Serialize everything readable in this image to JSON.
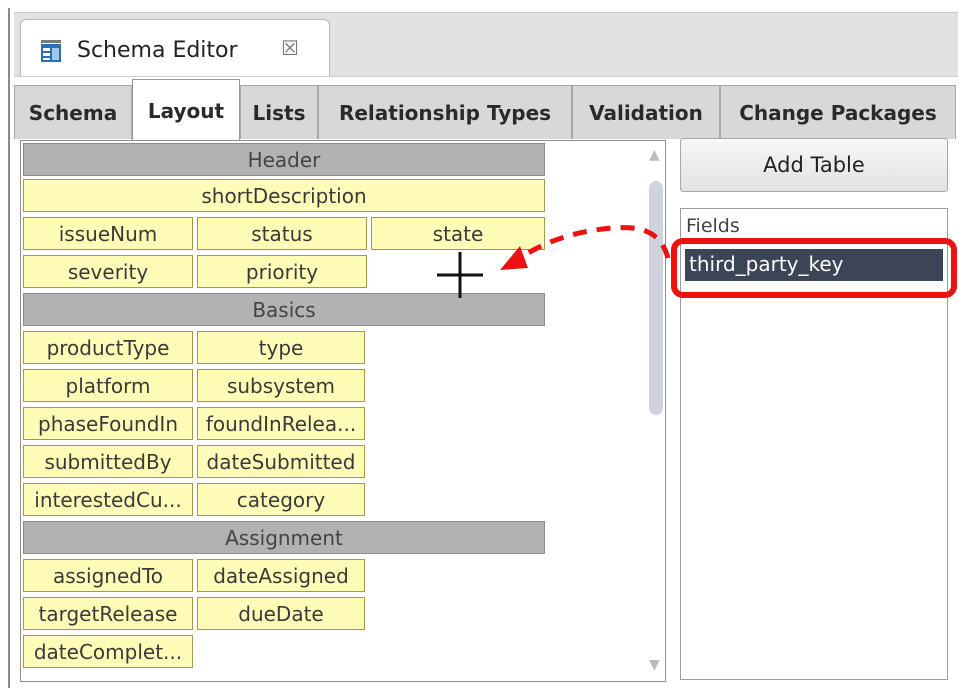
{
  "editor_tab": {
    "title": "Schema Editor",
    "close_glyph": "☒"
  },
  "tabs": [
    {
      "label": "Schema",
      "active": false
    },
    {
      "label": "Layout",
      "active": true
    },
    {
      "label": "Lists",
      "active": false
    },
    {
      "label": "Relationship Types",
      "active": false
    },
    {
      "label": "Validation",
      "active": false
    },
    {
      "label": "Change Packages",
      "active": false
    }
  ],
  "layout": {
    "sections": {
      "header": "Header",
      "basics": "Basics",
      "assignment": "Assignment"
    },
    "fields": {
      "shortDescription": "shortDescription",
      "issueNum": "issueNum",
      "status": "status",
      "state": "state",
      "severity": "severity",
      "priority": "priority",
      "productType": "productType",
      "type": "type",
      "platform": "platform",
      "subsystem": "subsystem",
      "phaseFoundIn": "phaseFoundIn",
      "foundInRelease": "foundInRelea...",
      "submittedBy": "submittedBy",
      "dateSubmitted": "dateSubmitted",
      "interestedCustomers": "interestedCu...",
      "category": "category",
      "assignedTo": "assignedTo",
      "dateAssigned": "dateAssigned",
      "targetRelease": "targetRelease",
      "dueDate": "dueDate",
      "dateCompleted": "dateComplet..."
    }
  },
  "right_panel": {
    "add_table_label": "Add Table",
    "fields_header": "Fields",
    "fields": [
      "third_party_key"
    ]
  },
  "colors": {
    "field_cell": "#fffcb8",
    "section_bar": "#b2b2b2",
    "selected_field": "#3c4555",
    "annotation_red": "#ee1111"
  },
  "icons": {
    "drop_cursor": "crosshair-icon",
    "annotation_arrow": "dashed-arrow-icon"
  }
}
